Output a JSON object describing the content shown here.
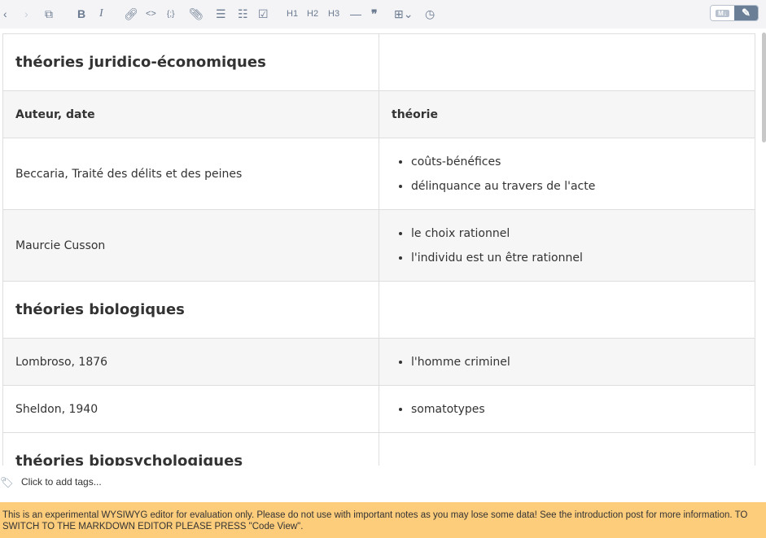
{
  "toolbar": {
    "buttons": [
      "chevron-left-icon",
      "chevron-right-icon",
      "external-link-icon",
      "bold-icon",
      "italic-icon",
      "link-icon",
      "code-icon",
      "code-block-icon",
      "attachment-icon",
      "ordered-list-icon",
      "bullet-list-icon",
      "checklist-icon",
      "hr-icon",
      "quote-icon",
      "table-icon",
      "clock-icon"
    ],
    "h1": "H1",
    "h2": "H2",
    "h3": "H3",
    "bold": "B",
    "italic": "I",
    "markdown_label": "M↓"
  },
  "table": {
    "heading1": "théories juridico-économiques",
    "col1": "Auteur, date",
    "col2": "théorie",
    "rows1": [
      {
        "author": "Beccaria, Traité des délits et des peines",
        "items": [
          "coûts-bénéfices",
          "délinquance au travers de l'acte"
        ]
      },
      {
        "author": "Maurcie Cusson",
        "items": [
          "le choix rationnel",
          "l'individu est un être rationnel"
        ]
      }
    ],
    "heading2": "théories biologiques",
    "rows2": [
      {
        "author": "Lombroso, 1876",
        "items": [
          "l'homme criminel"
        ]
      },
      {
        "author": "Sheldon, 1940",
        "items": [
          "somatotypes"
        ]
      }
    ],
    "heading3": "théories biopsychologiques"
  },
  "tags": {
    "placeholder": "Click to add tags..."
  },
  "banner": {
    "text": "This is an experimental WYSIWYG editor for evaluation only. Please do not use with important notes as you may lose some data! See the introduction post for more information. TO SWITCH TO THE MARKDOWN EDITOR PLEASE PRESS \"Code View\"."
  },
  "colors": {
    "banner": "#fecd7c",
    "toolbar": "#f4f4f6",
    "active_toggle": "#6a7f96"
  }
}
